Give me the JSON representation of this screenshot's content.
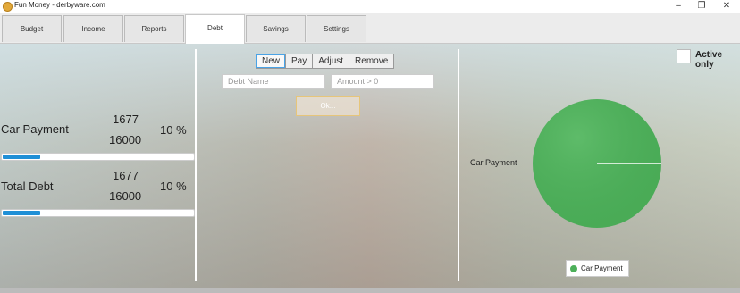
{
  "window": {
    "title": "Fun Money - derbyware.com",
    "minimize": "–",
    "restore": "❐",
    "close": "✕"
  },
  "tabs": [
    {
      "label": "Budget"
    },
    {
      "label": "Income"
    },
    {
      "label": "Reports"
    },
    {
      "label": "Debt"
    },
    {
      "label": "Savings"
    },
    {
      "label": "Settings"
    }
  ],
  "active_tab": "Debt",
  "debts": [
    {
      "name": "Car Payment",
      "paid": "1677",
      "total": "16000",
      "percent": "10 %",
      "progress": 0.1048
    },
    {
      "name": "Total Debt",
      "paid": "1677",
      "total": "16000",
      "percent": "10 %",
      "progress": 0.1048
    }
  ],
  "actions": {
    "new": "New",
    "pay": "Pay",
    "adjust": "Adjust",
    "remove": "Remove"
  },
  "form": {
    "name_placeholder": "Debt Name",
    "amount_placeholder": "Amount > 0",
    "ok": "Ok..."
  },
  "filter": {
    "active_only": "Active only"
  },
  "chart": {
    "slice_label": "Car Payment",
    "legend": "Car Payment",
    "color": "#4db05a"
  },
  "chart_data": {
    "type": "pie",
    "categories": [
      "Car Payment"
    ],
    "values": [
      100
    ]
  }
}
